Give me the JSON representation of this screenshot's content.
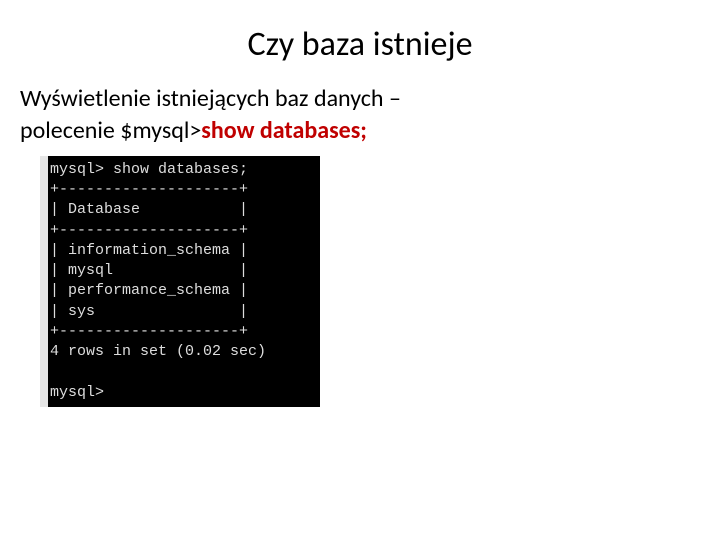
{
  "title": "Czy baza istnieje",
  "body": {
    "line1": "Wyświetlenie istniejących baz danych –",
    "line2_prefix": "polecenie $mysql>",
    "line2_cmd": "show databases;"
  },
  "terminal": {
    "prompt_cmd": "mysql> show databases;",
    "border": "+--------------------+",
    "header": "| Database           |",
    "rows": [
      "| information_schema |",
      "| mysql              |",
      "| performance_schema |",
      "| sys                |"
    ],
    "status": "4 rows in set (0.02 sec)",
    "prompt_end": "mysql>"
  }
}
